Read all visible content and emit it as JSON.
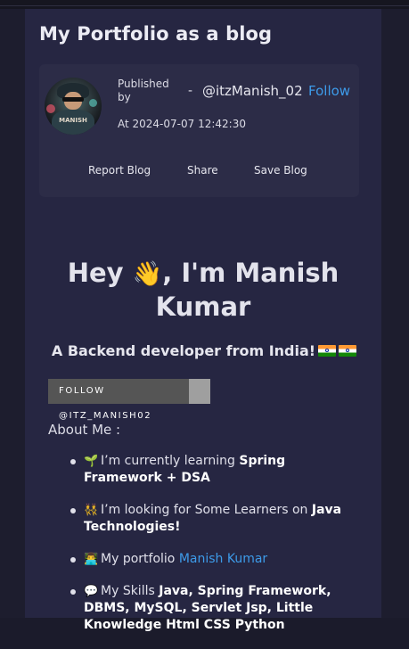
{
  "blog": {
    "title": "My Portfolio as a blog"
  },
  "author_card": {
    "published_by_label": "Published by",
    "separator": "-",
    "author_handle": "@itzManish_02",
    "follow_label": "Follow",
    "date_text": "At 2024-07-07 12:42:30",
    "avatar_text": "MANISH",
    "actions": [
      "Report Blog",
      "Share",
      "Save Blog"
    ]
  },
  "content": {
    "hero_prefix": "Hey ",
    "hero_suffix": ", I'm Manish Kumar",
    "hero_emoji_icon": "waving-hand-icon",
    "subtitle": "A Backend developer from India!",
    "flag_icon": "india-flag-icon",
    "badge_label": "FOLLOW @ITZ_MANISH02",
    "about_label": "About Me :",
    "items": [
      {
        "icon": "seedling-icon",
        "text": "I’m currently learning ",
        "bold": "Spring Framework + DSA"
      },
      {
        "icon": "people-icon",
        "text": "I’m looking for Some Learners on ",
        "bold": "Java Technologies!"
      },
      {
        "icon": "technologist-icon",
        "text": "My portfolio ",
        "link": "Manish Kumar"
      },
      {
        "icon": "speech-bubble-icon",
        "text": "My Skills ",
        "bold": "Java, Spring Framework, DBMS, MySQL, Servlet Jsp, Little Knowledge Html CSS Python"
      }
    ]
  },
  "colors": {
    "background": "#1b1b2b",
    "panel": "#262642",
    "card": "#2c2c47",
    "link": "#3d9be9",
    "badge_left": "#555555",
    "badge_right": "#9f9f9f"
  }
}
